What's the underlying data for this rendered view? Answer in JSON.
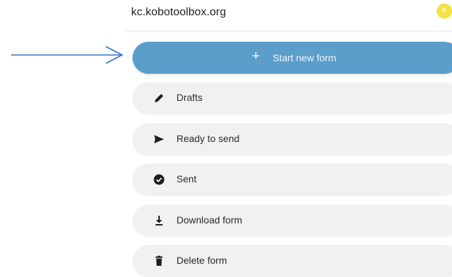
{
  "header": {
    "server": "kc.kobotoolbox.org",
    "avatar_initial": "K"
  },
  "annotation": {
    "arrow_color": "#2f6fd0"
  },
  "menu": {
    "start_new_form": {
      "label": "Start new form",
      "icon": "plus-icon",
      "color": "#5b9ec9"
    },
    "drafts": {
      "label": "Drafts",
      "icon": "pencil-icon"
    },
    "ready_to_send": {
      "label": "Ready to send",
      "icon": "send-icon"
    },
    "sent": {
      "label": "Sent",
      "icon": "check-circle-icon"
    },
    "download_form": {
      "label": "Download form",
      "icon": "download-icon"
    },
    "delete_form": {
      "label": "Delete form",
      "icon": "trash-icon"
    }
  }
}
